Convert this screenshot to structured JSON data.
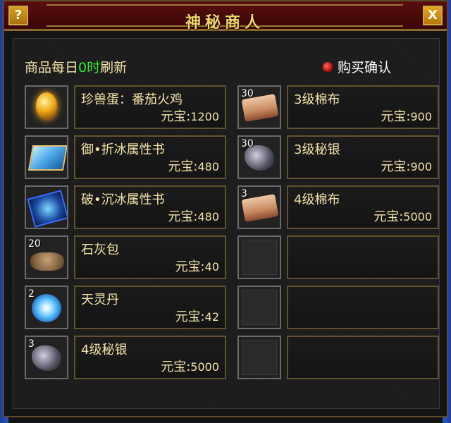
{
  "window": {
    "title": "神秘商人",
    "help_label": "?",
    "close_label": "X"
  },
  "header": {
    "refresh_prefix": "商品每日",
    "refresh_hour": "0时",
    "refresh_suffix": "刷新",
    "confirm_label": "购买确认"
  },
  "currency_label": "元宝:",
  "left_items": [
    {
      "name": "珍兽蛋：番茄火鸡",
      "price": "1200",
      "qty": "",
      "icon": "egg-icon"
    },
    {
      "name": "御•折冰属性书",
      "price": "480",
      "qty": "",
      "icon": "ice-book-icon"
    },
    {
      "name": "破•沉冰属性书",
      "price": "480",
      "qty": "",
      "icon": "dark-ice-book-icon"
    },
    {
      "name": "石灰包",
      "price": "40",
      "qty": "20",
      "icon": "lime-pack-icon"
    },
    {
      "name": "天灵丹",
      "price": "42",
      "qty": "2",
      "icon": "spirit-pill-icon"
    },
    {
      "name": "4级秘银",
      "price": "5000",
      "qty": "3",
      "icon": "mithril-ore-icon"
    }
  ],
  "right_items": [
    {
      "name": "3级棉布",
      "price": "900",
      "qty": "30",
      "icon": "cotton-cloth-icon"
    },
    {
      "name": "3级秘银",
      "price": "900",
      "qty": "30",
      "icon": "mithril-ore-icon"
    },
    {
      "name": "4级棉布",
      "price": "5000",
      "qty": "3",
      "icon": "cotton-cloth-icon"
    }
  ],
  "colors": {
    "text_gold": "#f2e3a8",
    "title_gold": "#f3d36a",
    "highlight_green": "#2ee82e",
    "title_bar_red": "#5a0d0d"
  }
}
